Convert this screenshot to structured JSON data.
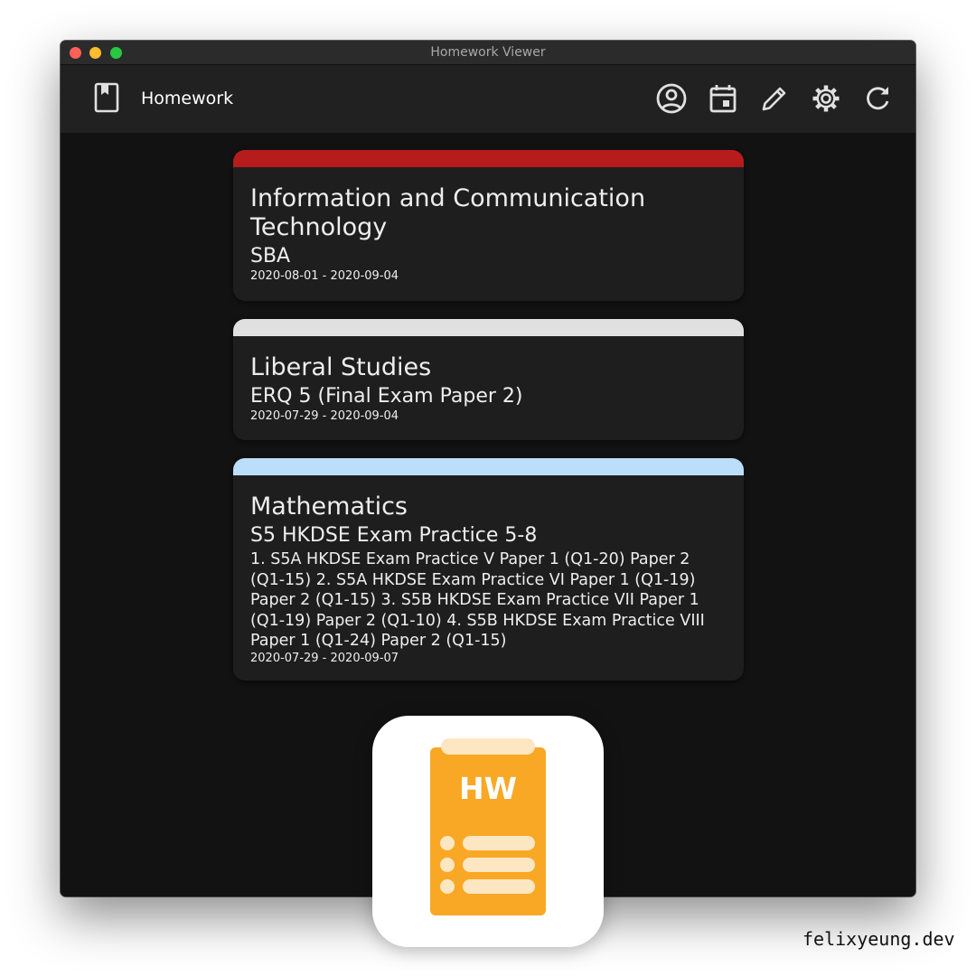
{
  "window": {
    "title": "Homework Viewer"
  },
  "appbar": {
    "title": "Homework",
    "actions": [
      {
        "icon": "account-circle-icon",
        "name": "account-button"
      },
      {
        "icon": "calendar-event-icon",
        "name": "calendar-button"
      },
      {
        "icon": "pencil-icon",
        "name": "edit-button"
      },
      {
        "icon": "gear-icon",
        "name": "settings-button"
      },
      {
        "icon": "refresh-icon",
        "name": "refresh-button"
      }
    ]
  },
  "homework": [
    {
      "subject": "Information and Communication Technology",
      "title": "SBA",
      "description": "",
      "dates": "2020-08-01 - 2020-09-04",
      "color": "#b71c1c"
    },
    {
      "subject": "Liberal Studies",
      "title": "ERQ 5 (Final Exam Paper 2)",
      "description": "",
      "dates": "2020-07-29 - 2020-09-04",
      "color": "#e0e0e0"
    },
    {
      "subject": "Mathematics",
      "title": "S5 HKDSE Exam Practice 5-8",
      "description": "1. S5A HKDSE Exam Practice V Paper 1 (Q1-20) Paper 2 (Q1-15) 2. S5A HKDSE Exam Practice VI Paper 1 (Q1-19) Paper 2 (Q1-15) 3. S5B HKDSE Exam Practice VII Paper 1 (Q1-19) Paper 2 (Q1-10) 4. S5B HKDSE Exam Practice VIII Paper 1 (Q1-24) Paper 2 (Q1-15)",
      "dates": "2020-07-29 - 2020-09-07",
      "color": "#bbdefb"
    }
  ],
  "app_icon": {
    "label": "HW",
    "primary_color": "#f9a825",
    "accent_color": "#fde7c3"
  },
  "watermark": "felixyeung.dev"
}
